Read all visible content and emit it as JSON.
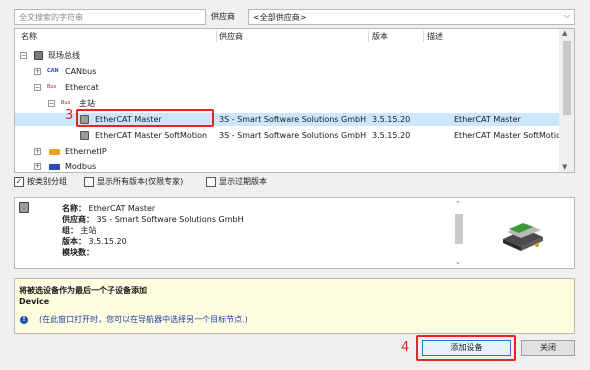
{
  "search": {
    "placeholder": "全文搜索的字符串"
  },
  "vendor": {
    "label": "供应商",
    "selected": "<全部供应商>"
  },
  "columns": {
    "name": "名称",
    "vendor": "供应商",
    "version": "版本",
    "description": "描述"
  },
  "tree": {
    "fieldbus": "现场总线",
    "canbus": "CANbus",
    "ethercat": "Ethercat",
    "master_group": "主站",
    "rows": [
      {
        "name": "EtherCAT Master",
        "vendor": "3S - Smart Software Solutions GmbH",
        "version": "3.5.15.20",
        "description": "EtherCAT Master"
      },
      {
        "name": "EtherCAT Master SoftMotion",
        "vendor": "3S - Smart Software Solutions GmbH",
        "version": "3.5.15.20",
        "description": "EtherCAT Master SoftMotion"
      }
    ],
    "ethernetip": "EthernetIP",
    "modbus": "Modbus",
    "icon_labels": {
      "can": "CAN",
      "bus": "Bus"
    }
  },
  "options": {
    "group_by_category": "按类别分组",
    "show_all_versions": "显示所有版本(仅限专家)",
    "show_outdated": "显示过期版本",
    "checked_symbol": "✓"
  },
  "details": {
    "name_key": "名称：",
    "name_val": "EtherCAT Master",
    "vendor_key": "供应商：",
    "vendor_val": "3S - Smart Software Solutions GmbH",
    "group_key": "组：",
    "group_val": "主站",
    "version_key": "版本：",
    "version_val": "3.5.15.20",
    "module_key": "模块数："
  },
  "info": {
    "title": "将被选设备作为最后一个子设备添加",
    "device": "Device",
    "note": "(在此窗口打开时，您可以在导航器中选择另一个目标节点.)"
  },
  "buttons": {
    "add": "添加设备",
    "close": "关闭"
  },
  "annotations": {
    "step3": "3",
    "step4": "4"
  },
  "colors": {
    "highlight": "#e3261f",
    "selection": "#cce6ff",
    "info_bg": "#fffde0"
  }
}
